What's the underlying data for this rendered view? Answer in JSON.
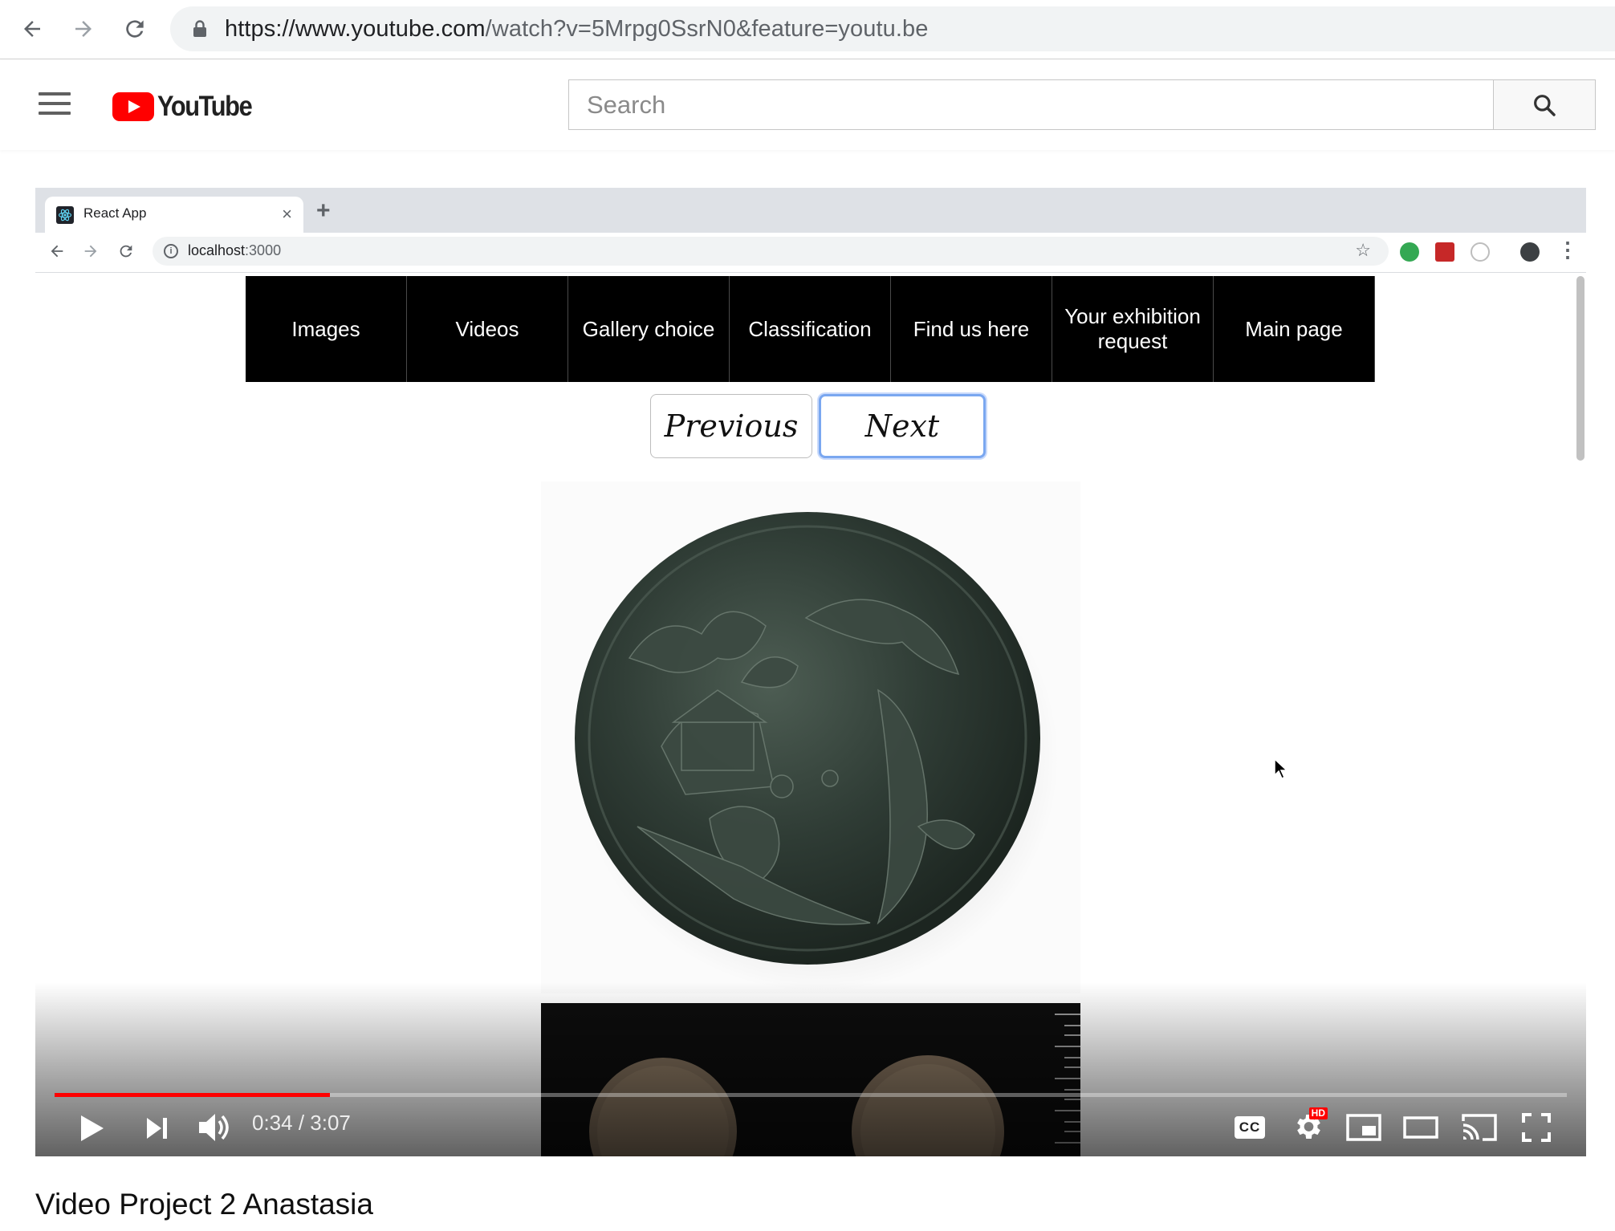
{
  "browser": {
    "url_host": "https://www.youtube.com",
    "url_path": "/watch?v=5Mrpg0SsrN0&feature=youtu.be"
  },
  "youtube": {
    "logo_text": "YouTube",
    "search_placeholder": "Search"
  },
  "inner_browser": {
    "tab_title": "React App",
    "address_host": "localhost",
    "address_port": ":3000"
  },
  "site": {
    "nav_items": [
      "Images",
      "Videos",
      "Gallery choice",
      "Classification",
      "Find us here",
      "Your exhibition request",
      "Main page"
    ],
    "prev_label": "Previous",
    "next_label": "Next"
  },
  "player": {
    "current_time": "0:34",
    "separator": " / ",
    "duration": "3:07",
    "progress_fraction": 0.182,
    "cc_label": "CC",
    "hd_badge": "HD",
    "accent_color": "#ff0000"
  },
  "video": {
    "title": "Video Project 2 Anastasia"
  }
}
